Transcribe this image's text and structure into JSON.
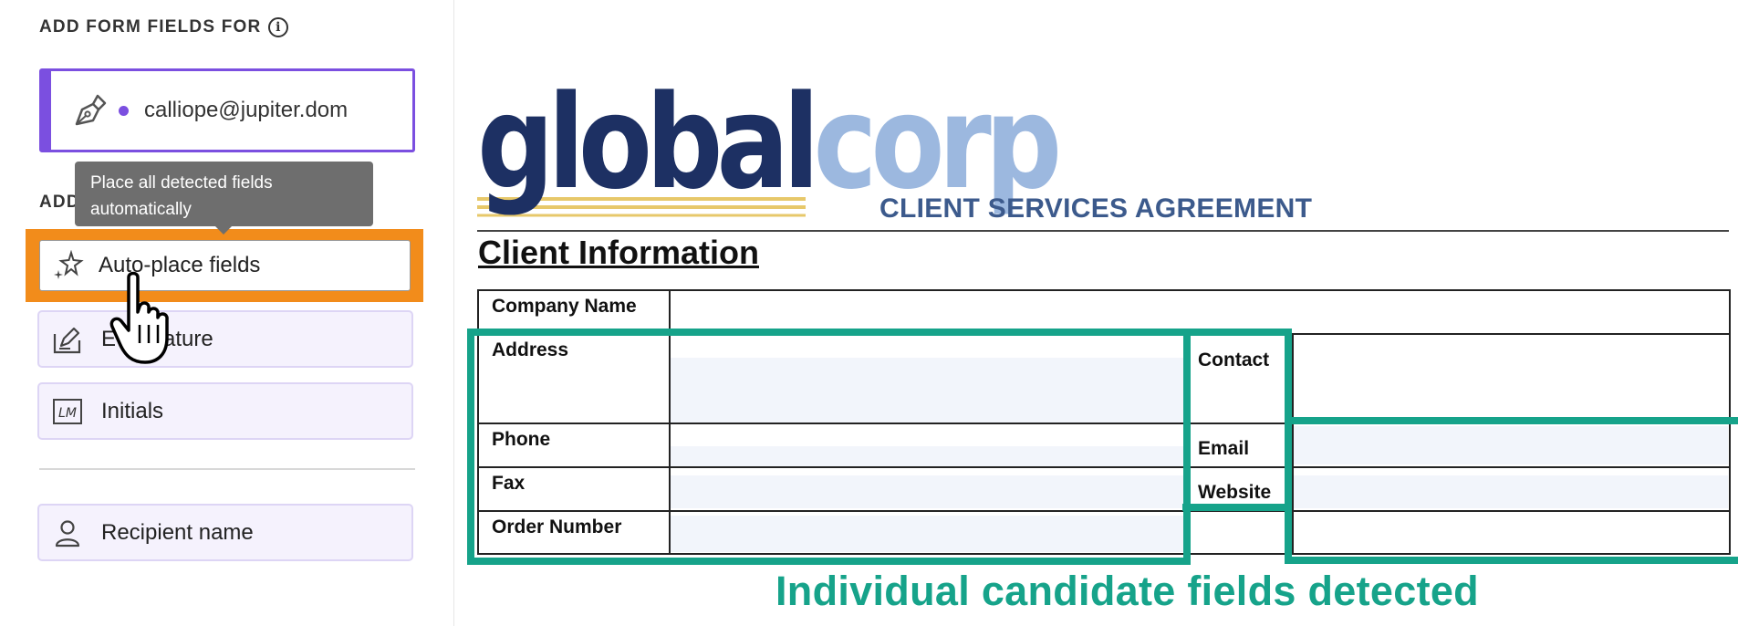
{
  "left_panel": {
    "heading": "ADD FORM FIELDS FOR",
    "info_icon": "i",
    "recipient": {
      "email": "calliope@jupiter.dom",
      "color": "#7b4fe0"
    },
    "section_label_partial": "ADD",
    "tooltip": "Place all detected fields automatically",
    "buttons": {
      "autoplace": "Auto-place fields",
      "esignature": "E-signature",
      "initials": "Initials",
      "recipient_name": "Recipient name"
    },
    "initials_icon_text": "LM"
  },
  "document": {
    "logo_part1": "global",
    "logo_part2": "corp",
    "title": "CLIENT SERVICES AGREEMENT",
    "section_heading": "Client Information",
    "labels": {
      "company_name": "Company Name",
      "address": "Address",
      "contact": "Contact",
      "phone": "Phone",
      "email": "Email",
      "fax": "Fax",
      "website": "Website",
      "order_number": "Order Number"
    }
  },
  "annotation": {
    "caption": "Individual candidate fields detected",
    "highlight_color": "#16a38a",
    "button_highlight_color": "#f28c1b"
  }
}
